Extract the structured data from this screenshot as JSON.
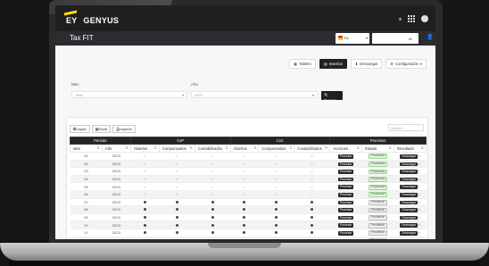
{
  "app": {
    "title": "Tax FIT",
    "brand_ey": "EY",
    "brand_name": "GENYUS"
  },
  "header": {
    "language": "Es",
    "right_box": "ID"
  },
  "toolbar": {
    "buttons": [
      {
        "label": "Tablero",
        "icon": "chart-icon",
        "active": false
      },
      {
        "label": "Insertos",
        "icon": "file-icon",
        "active": true
      },
      {
        "label": "Descargas",
        "icon": "download-icon",
        "active": false
      },
      {
        "label": "Configuración",
        "icon": "gear-icon",
        "active": false
      }
    ]
  },
  "filters": {
    "mes_label": "Mes",
    "mes_value": "Todo",
    "anio_label": "Año",
    "anio_value": "2023",
    "search_button": "Buscar"
  },
  "exports": {
    "copy": "Copiar",
    "excel": "Excel",
    "print": "Imprimir"
  },
  "table_search": {
    "placeholder": "Search:"
  },
  "table": {
    "group_headers": [
      "Periodo",
      "CxP",
      "CxC",
      "Procesos"
    ],
    "columns": [
      "Mes",
      "Año",
      "Abiertos",
      "Compensados",
      "Contabilizados",
      "Abiertos",
      "Compensados",
      "Contabilizados",
      "Acciones",
      "Estado",
      "Resultado"
    ],
    "rows": [
      {
        "mes": "01",
        "anio": "2023",
        "status": "done"
      },
      {
        "mes": "02",
        "anio": "2023",
        "status": "done"
      },
      {
        "mes": "03",
        "anio": "2023",
        "status": "done"
      },
      {
        "mes": "04",
        "anio": "2023",
        "status": "done"
      },
      {
        "mes": "05",
        "anio": "2023",
        "status": "done"
      },
      {
        "mes": "06",
        "anio": "2023",
        "status": "done"
      },
      {
        "mes": "07",
        "anio": "2023",
        "status": "pending"
      },
      {
        "mes": "08",
        "anio": "2023",
        "status": "pending"
      },
      {
        "mes": "09",
        "anio": "2023",
        "status": "pending"
      },
      {
        "mes": "10",
        "anio": "2023",
        "status": "pending"
      },
      {
        "mes": "11",
        "anio": "2023",
        "status": "pending"
      },
      {
        "mes": "12",
        "anio": "2023",
        "status": "pending"
      }
    ],
    "action_label": "Procesar",
    "state_done": "Procesado",
    "state_pending": "Pendiente",
    "result_label": "Descargar"
  },
  "colors": {
    "accent": "#ffe600",
    "dark": "#1f1f22",
    "success": "#3c763d"
  }
}
